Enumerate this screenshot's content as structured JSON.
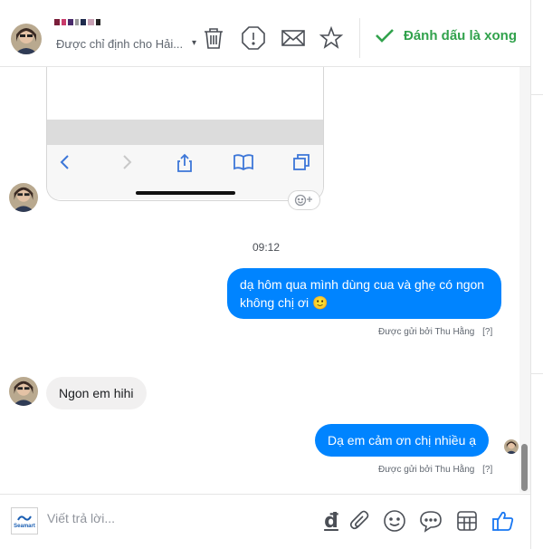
{
  "header": {
    "assigned_text": "Được chỉ định cho Hải...",
    "caret": "▾",
    "done_label": "Đánh dấu là xong",
    "colors": {
      "done": "#31a24c",
      "icon": "#4b4f56"
    },
    "icons": [
      "trash-icon",
      "alert-icon",
      "mail-icon",
      "star-icon",
      "check-icon"
    ]
  },
  "conversation": {
    "timestamp": "09:12",
    "messages": [
      {
        "direction": "out",
        "text": "dạ hôm qua mình dùng cua và ghẹ có ngon không chị ơi",
        "emoji": "🙂",
        "sent_by": "Được gửi bởi Thu Hằng",
        "help": "[?]"
      },
      {
        "direction": "in",
        "text": "Ngon em hihi"
      },
      {
        "direction": "out",
        "text": "Dạ em cảm ơn chị nhiều ạ",
        "sent_by": "Được gửi bởi Thu Hằng",
        "help": "[?]"
      }
    ],
    "colors": {
      "outgoing": "#0084ff",
      "incoming": "#f1f0f0"
    }
  },
  "composer": {
    "placeholder": "Viết trả lời...",
    "logo_text": "Seamart",
    "currency_symbol": "đ",
    "icons": [
      "dong-icon",
      "attachment-icon",
      "emoji-icon",
      "saved-reply-icon",
      "template-icon",
      "like-icon"
    ]
  }
}
